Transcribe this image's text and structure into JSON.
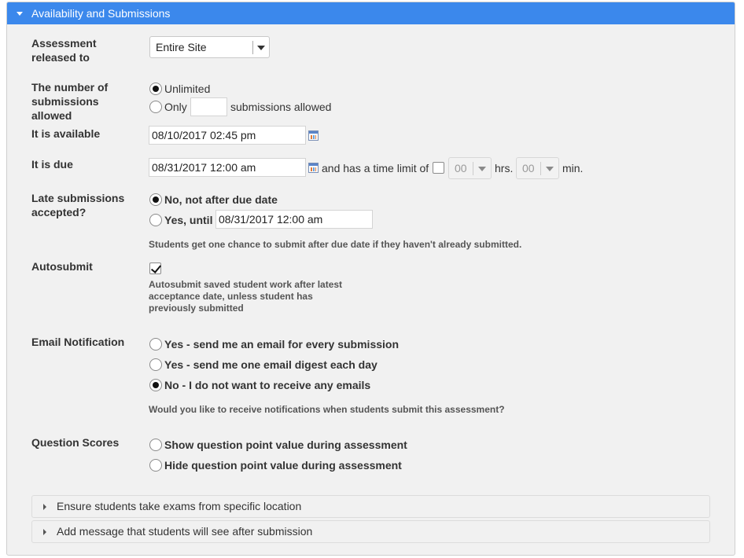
{
  "section_title": "Availability and Submissions",
  "released_to": {
    "label": "Assessment released to",
    "value": "Entire Site"
  },
  "submissions": {
    "label": "The number of submissions allowed",
    "unlimited": "Unlimited",
    "only": "Only",
    "only_value": "",
    "suffix": "submissions allowed",
    "selected": "unlimited"
  },
  "available": {
    "label": "It is available",
    "value": "08/10/2017 02:45 pm"
  },
  "due": {
    "label": "It is due",
    "value": "08/31/2017 12:00 am",
    "time_limit_text": "and has a time limit of",
    "hours_value": "00",
    "hours_unit": "hrs.",
    "minutes_value": "00",
    "minutes_unit": "min."
  },
  "late": {
    "label": "Late submissions accepted?",
    "no_option": "No, not after due date",
    "yes_option": "Yes, until",
    "yes_date": "08/31/2017 12:00 am",
    "hint": "Students get one chance to submit after due date if they haven't already submitted.",
    "selected": "no"
  },
  "autosubmit": {
    "label": "Autosubmit",
    "checked": true,
    "hint_line1": "Autosubmit saved student work after latest",
    "hint_line2": "acceptance date, unless student has",
    "hint_line3": "previously submitted"
  },
  "email": {
    "label": "Email Notification",
    "options": [
      "Yes - send me an email for every submission",
      "Yes - send me one email digest each day",
      "No - I do not want to receive any emails"
    ],
    "selected_index": 2,
    "hint": "Would you like to receive notifications when students submit this assessment?"
  },
  "scores": {
    "label": "Question Scores",
    "options": [
      "Show question point value during assessment",
      "Hide question point value during assessment"
    ]
  },
  "collapsibles": [
    "Ensure students take exams from specific location",
    "Add message that students will see after submission"
  ],
  "colors": {
    "header_bg": "#3b88ec",
    "panel_bg": "#f1f1f1"
  }
}
